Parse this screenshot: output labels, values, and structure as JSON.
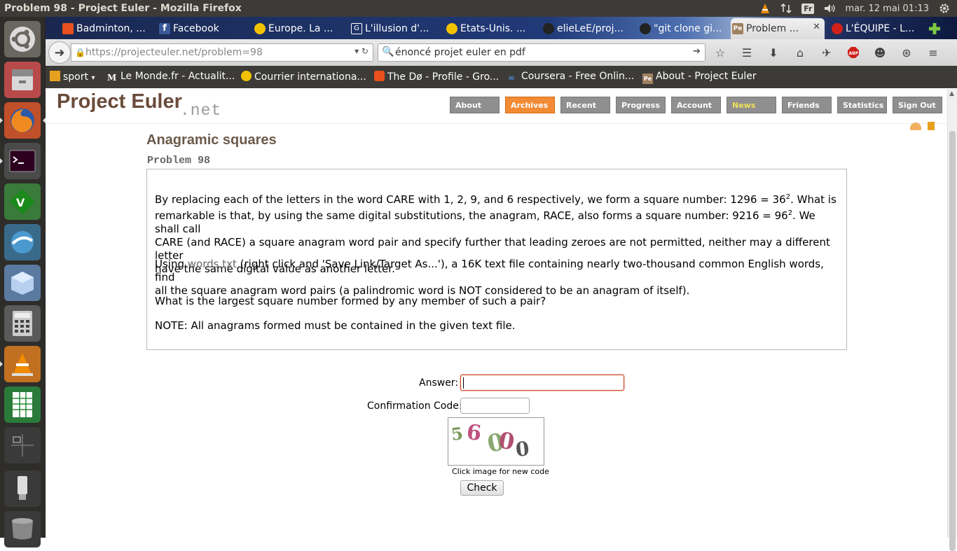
{
  "system": {
    "window_title": "Problem 98 - Project Euler - Mozilla Firefox",
    "keyboard_layout": "Fr",
    "clock": "mar. 12 mai 01:13"
  },
  "tabs": [
    {
      "label": "Badminton, ...",
      "icon": "badminton-icon",
      "color": "#e8501e"
    },
    {
      "label": "Facebook",
      "icon": "facebook-icon",
      "color": "#3b5998"
    },
    {
      "label": "Europe. La ...",
      "icon": "courrier-icon",
      "color": "#f2c200"
    },
    {
      "label": "L'illusion d'...",
      "icon": "gs-icon",
      "color": "#ffffff"
    },
    {
      "label": "Etats-Unis. ...",
      "icon": "courrier-icon",
      "color": "#f2c200"
    },
    {
      "label": "elieLeE/proj...",
      "icon": "github-icon",
      "color": "#222222"
    },
    {
      "label": "\"git clone gi...",
      "icon": "github-icon",
      "color": "#222222"
    },
    {
      "label": "Problem ...",
      "icon": "project-euler-icon",
      "color": "#a08060",
      "active": true
    },
    {
      "label": "L'ÉQUIPE - L...",
      "icon": "lequipe-icon",
      "color": "#d0201a"
    }
  ],
  "navbar": {
    "url_host": "https://projecteuler.net",
    "url_path": "/problem=98",
    "search_text": "énoncé projet euler en pdf"
  },
  "bookmarks": [
    {
      "label": "sport",
      "icon": "folder-icon"
    },
    {
      "label": "Le Monde.fr - Actualit...",
      "icon": "lemonde-icon"
    },
    {
      "label": "Courrier internationa...",
      "icon": "courrier-icon"
    },
    {
      "label": "The Dø - Profile - Gro...",
      "icon": "lastfm-icon"
    },
    {
      "label": "Coursera - Free Onlin...",
      "icon": "coursera-icon"
    },
    {
      "label": "About - Project Euler",
      "icon": "project-euler-icon"
    }
  ],
  "site": {
    "logo_main": "Project Euler",
    "logo_net": ".net",
    "nav": [
      "About",
      "Archives",
      "Recent",
      "Progress",
      "Account",
      "News",
      "Friends",
      "Statistics",
      "Sign Out"
    ]
  },
  "problem": {
    "title": "Anagramic squares",
    "number": "Problem 98",
    "p1_a": "By replacing each of the letters in the word CARE with 1, 2, 9, and 6 respectively, we form a square number: 1296 = 36",
    "p1_b": ". What is",
    "p1_c": "remarkable is that, by using the same digital substitutions, the anagram, RACE, also forms a square number: 9216 = 96",
    "p1_d": ". We shall call",
    "p1_e": "CARE (and RACE) a square anagram word pair and specify further that leading zeroes are not permitted, neither may a different letter",
    "p1_f": "have the same digital value as another letter.",
    "sup": "2",
    "p2_a": "Using ",
    "p2_link": "words.txt",
    "p2_b": " (right click and 'Save Link/Target As...'), a 16K text file containing nearly two-thousand common English words, find",
    "p2_c": "all the square anagram word pairs (a palindromic word is NOT considered to be an anagram of itself).",
    "p3": "What is the largest square number formed by any member of such a pair?",
    "p4": "NOTE: All anagrams formed must be contained in the given text file."
  },
  "form": {
    "answer_label": "Answer:",
    "confirmation_label": "Confirmation Code:",
    "captcha_digits": [
      "5",
      "6",
      "0",
      "0",
      "0"
    ],
    "captcha_note": "Click image for new code",
    "check_label": "Check"
  }
}
